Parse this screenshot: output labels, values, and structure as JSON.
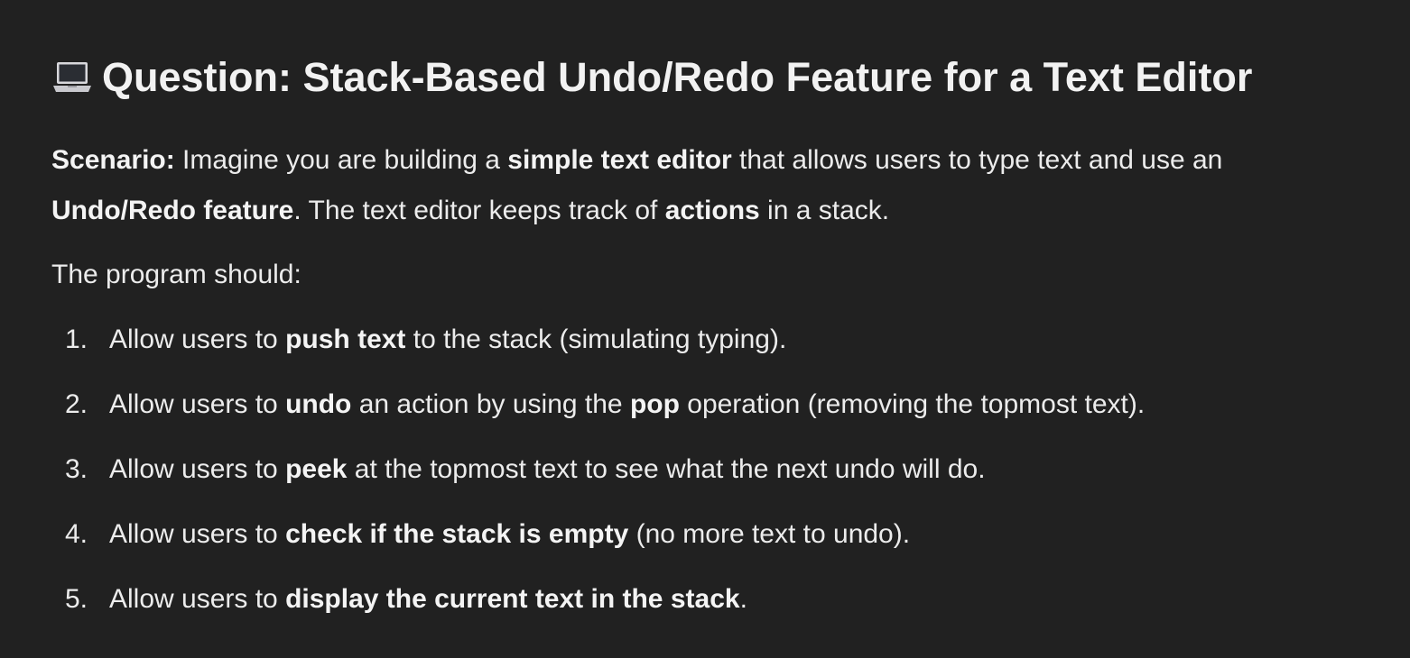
{
  "title": {
    "icon": "laptop-icon",
    "text": "Question: Stack-Based Undo/Redo Feature for a Text Editor"
  },
  "scenario": {
    "label": "Scenario:",
    "t1": " Imagine you are building a ",
    "b1": "simple text editor",
    "t2": " that allows users to type text and use an ",
    "b2": "Undo/Redo feature",
    "t3": ". The text editor keeps track of ",
    "b3": "actions",
    "t4": " in a stack."
  },
  "lead": "The program should:",
  "steps": [
    {
      "num": "1.",
      "pre": "Allow users to ",
      "bold": "push text",
      "post": " to the stack (simulating typing)."
    },
    {
      "num": "2.",
      "pre": "Allow users to ",
      "bold": "undo",
      "mid": " an action by using the ",
      "bold2": "pop",
      "post": " operation (removing the topmost text)."
    },
    {
      "num": "3.",
      "pre": "Allow users to ",
      "bold": "peek",
      "post": " at the topmost text to see what the next undo will do."
    },
    {
      "num": "4.",
      "pre": "Allow users to ",
      "bold": "check if the stack is empty",
      "post": " (no more text to undo)."
    },
    {
      "num": "5.",
      "pre": "Allow users to ",
      "bold": "display the current text in the stack",
      "post": "."
    }
  ]
}
